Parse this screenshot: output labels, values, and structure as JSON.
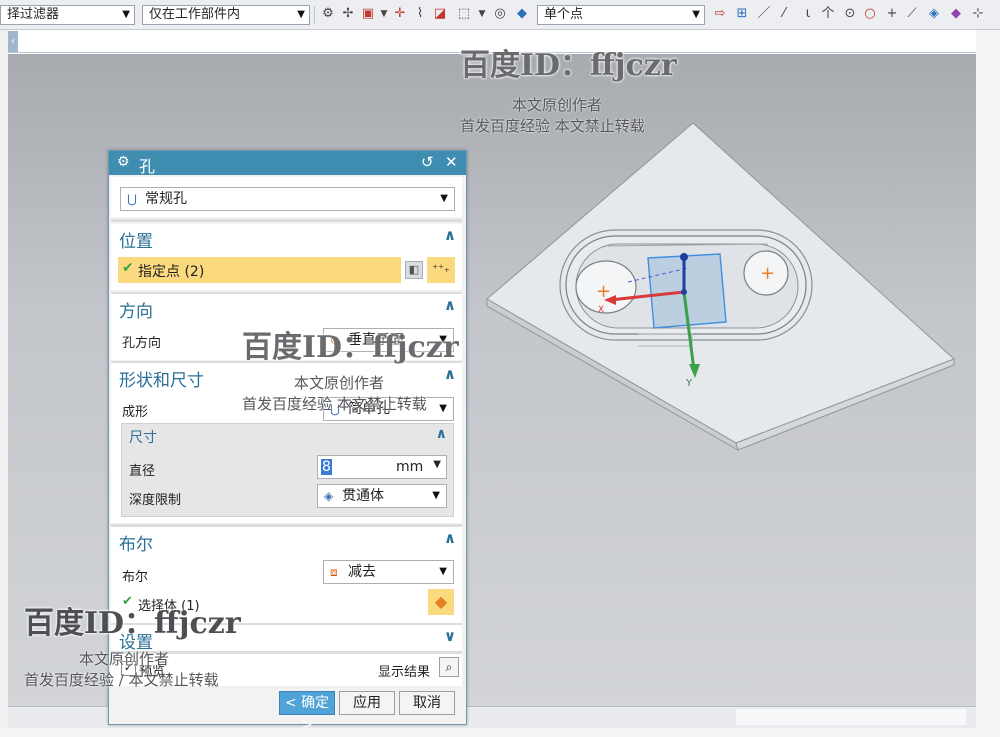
{
  "toolbar": {
    "filter_label": "择过滤器",
    "scope_label": "仅在工作部件内",
    "snap_label": "单个点"
  },
  "dialog": {
    "title": "孔",
    "type_value": "常规孔",
    "position": {
      "header": "位置",
      "specify_point": "指定点 (2)"
    },
    "direction": {
      "header": "方向",
      "hole_direction_label": "孔方向",
      "hole_direction_value": "垂直于面"
    },
    "shape": {
      "header": "形状和尺寸",
      "form_label": "成形",
      "form_value": "简单孔",
      "dims": {
        "header": "尺寸",
        "diameter_label": "直径",
        "diameter_value": "8",
        "diameter_unit": "mm",
        "depth_label": "深度限制",
        "depth_value": "贯通体"
      }
    },
    "boolean": {
      "header": "布尔",
      "boolean_label": "布尔",
      "boolean_value": "减去",
      "select_body": "选择体 (1)"
    },
    "settings": {
      "header": "设置"
    },
    "preview": {
      "label": "预览",
      "show_result": "显示结果"
    },
    "buttons": {
      "ok": "< 确定 >",
      "apply": "应用",
      "cancel": "取消"
    }
  },
  "viewport": {
    "axis_x": "X",
    "axis_y": "Y"
  },
  "watermarks": [
    {
      "big": "百度ID：ffjczr",
      "line1": "本文原创作者",
      "line2": "首发百度经验  本文禁止转载"
    },
    {
      "big": "百度ID：ffjczr",
      "line1": "本文原创作者",
      "line2": "首发百度经验  本文禁止转载"
    },
    {
      "big": "百度ID：ffjczr",
      "line1": "本文原创作者",
      "line2": "首发百度经验 / 本文禁止转载"
    }
  ],
  "colors": {
    "dialog_title_bg": "#3f8db0",
    "section_header": "#2a6f96",
    "selected_row": "#fbd97e",
    "ok_button": "#4fa3d6",
    "axis_x": "#d83a3a",
    "axis_y": "#3aa04a",
    "axis_z": "#1f3fa0"
  }
}
